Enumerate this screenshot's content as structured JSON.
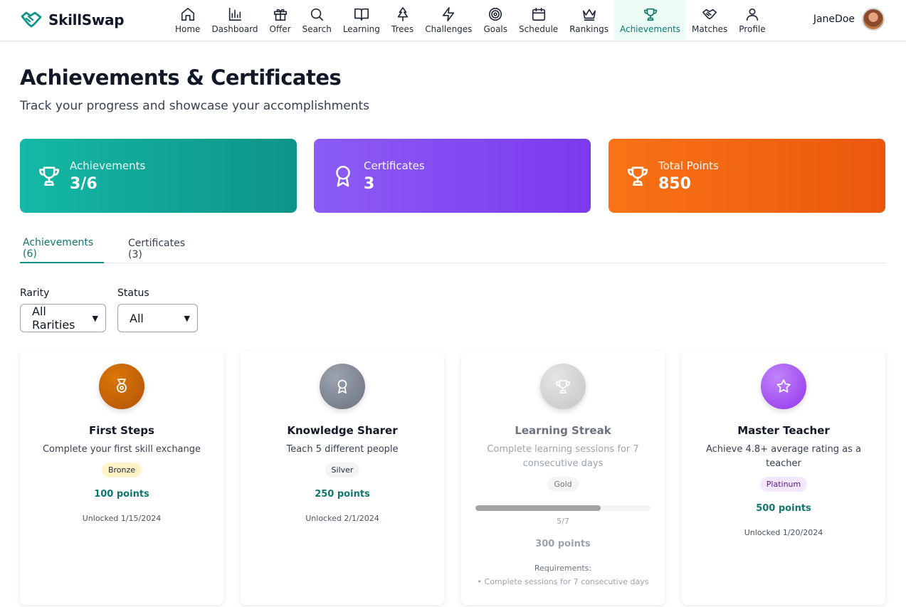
{
  "app": {
    "name": "SkillSwap"
  },
  "nav": {
    "items": [
      {
        "label": "Home",
        "icon": "home-icon"
      },
      {
        "label": "Dashboard",
        "icon": "bar-chart-icon"
      },
      {
        "label": "Offer",
        "icon": "gift-icon"
      },
      {
        "label": "Search",
        "icon": "search-icon"
      },
      {
        "label": "Learning",
        "icon": "book-icon"
      },
      {
        "label": "Trees",
        "icon": "tree-icon"
      },
      {
        "label": "Challenges",
        "icon": "lightning-icon"
      },
      {
        "label": "Goals",
        "icon": "target-icon"
      },
      {
        "label": "Schedule",
        "icon": "calendar-icon"
      },
      {
        "label": "Rankings",
        "icon": "crown-icon"
      },
      {
        "label": "Achievements",
        "icon": "trophy-icon",
        "active": true
      },
      {
        "label": "Matches",
        "icon": "handshake-icon"
      },
      {
        "label": "Profile",
        "icon": "user-icon"
      }
    ],
    "active_color": "#0f766e"
  },
  "user": {
    "name": "JaneDoe"
  },
  "header": {
    "title": "Achievements & Certificates",
    "subtitle": "Track your progress and showcase your accomplishments"
  },
  "stats": {
    "achievements": {
      "label": "Achievements",
      "value": "3/6",
      "color": "#14b8a6"
    },
    "certificates": {
      "label": "Certificates",
      "value": "3",
      "color": "#8b5cf6"
    },
    "points": {
      "label": "Total Points",
      "value": "850",
      "color": "#f97316"
    }
  },
  "tabs": [
    {
      "label": "Achievements (6)",
      "active": true
    },
    {
      "label": "Certificates (3)",
      "active": false
    }
  ],
  "filters": {
    "rarity": {
      "label": "Rarity",
      "value": "All Rarities"
    },
    "status": {
      "label": "Status",
      "value": "All"
    }
  },
  "cards": [
    {
      "title": "First Steps",
      "description": "Complete your first skill exchange",
      "rarity": "Bronze",
      "points": "100 points",
      "unlocked": "Unlocked 1/15/2024",
      "icon": "medal-icon",
      "badge_color": "#c2410c"
    },
    {
      "title": "Knowledge Sharer",
      "description": "Teach 5 different people",
      "rarity": "Silver",
      "points": "250 points",
      "unlocked": "Unlocked 2/1/2024",
      "icon": "award-ribbon-icon",
      "badge_color": "#6b7280"
    },
    {
      "title": "Learning Streak",
      "description": "Complete learning sessions for 7 consecutive days",
      "rarity": "Gold",
      "progress_text": "5/7",
      "progress_fraction": 0.714,
      "points": "300 points",
      "requirements_title": "Requirements:",
      "requirements": [
        "• Complete sessions for 7 consecutive days"
      ],
      "icon": "trophy-icon",
      "badge_color": "#d4d4d4",
      "locked": true
    },
    {
      "title": "Master Teacher",
      "description": "Achieve 4.8+ average rating as a teacher",
      "rarity": "Platinum",
      "points": "500 points",
      "unlocked": "Unlocked 1/20/2024",
      "icon": "star-icon",
      "badge_color": "#a855f7"
    }
  ]
}
